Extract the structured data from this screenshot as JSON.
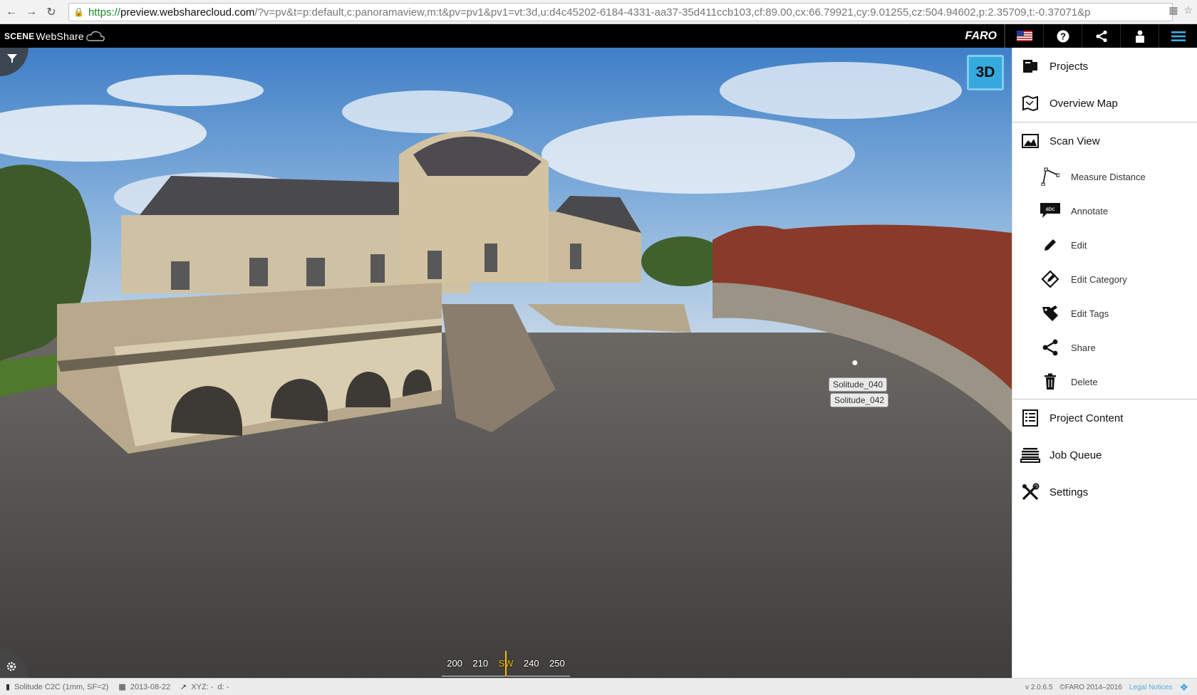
{
  "browser": {
    "url_scheme": "https://",
    "url_host": "preview.websharecloud.com",
    "url_rest": "/?v=pv&t=p:default,c:panoramaview,m:t&pv=pv1&pv1=vt:3d,u:d4c45202-6184-4331-aa37-35d411ccb103,cf:89.00,cx:66.79921,cy:9.01255,cz:504.94602,p:2.35709,t:-0.37071&p"
  },
  "app": {
    "brand_scene": "SCENE",
    "brand_webshare": "WebShare",
    "vendor": "FARO"
  },
  "viewer": {
    "mode_button": "3D",
    "scan_labels": [
      "Solitude_040",
      "Solitude_042"
    ],
    "compass": {
      "ticks": [
        "200",
        "210",
        "SW",
        "240",
        "250"
      ]
    }
  },
  "side_menu": {
    "projects": "Projects",
    "overview_map": "Overview Map",
    "scan_view": "Scan View",
    "tools": [
      {
        "label": "Measure Distance",
        "icon": "measure-distance-icon"
      },
      {
        "label": "Annotate",
        "icon": "annotate-icon"
      },
      {
        "label": "Edit",
        "icon": "pencil-icon"
      },
      {
        "label": "Edit Category",
        "icon": "edit-category-icon"
      },
      {
        "label": "Edit Tags",
        "icon": "edit-tags-icon"
      },
      {
        "label": "Share",
        "icon": "share-icon"
      },
      {
        "label": "Delete",
        "icon": "trash-icon"
      }
    ],
    "project_content": "Project Content",
    "job_queue": "Job Queue",
    "settings": "Settings"
  },
  "status_bar": {
    "scan_name": "Solitude C2C (1mm, SF=2)",
    "date": "2013-08-22",
    "xyz": "XYZ: -",
    "d": "d: -",
    "version": "v 2.0.6.5",
    "copyright": "©FARO 2014–2016",
    "legal": "Legal Notices"
  },
  "colors": {
    "accent": "#36a9df",
    "compass_needle": "#f5b800",
    "topbar": "#000000"
  }
}
